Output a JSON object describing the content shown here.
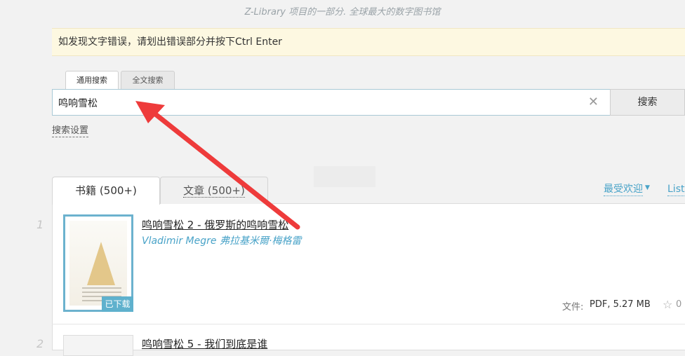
{
  "header": {
    "tagline": "Z-Library 项目的一部分. 全球最大的数字图书馆"
  },
  "notice": {
    "text": "如发现文字错误，请划出错误部分并按下Ctrl Enter"
  },
  "search": {
    "tabs": [
      {
        "label": "通用搜索"
      },
      {
        "label": "全文搜索"
      }
    ],
    "query": "鸣响雪松",
    "clear_icon": "close-icon",
    "button_label": "搜索",
    "settings_label": "搜索设置"
  },
  "results": {
    "tabs": [
      {
        "label": "书籍 (500+)"
      },
      {
        "label": "文章 (500+)"
      }
    ],
    "sort_label": "最受欢迎",
    "view_label": "List",
    "items": [
      {
        "number": "1",
        "title": "鸣响雪松 2 - 俄罗斯的鸣响雪松",
        "author": "Vladimir Megre 弗拉基米爾·梅格雷",
        "badge": "已下载",
        "file_label": "文件:",
        "file_info": "PDF, 5.27 MB",
        "star_count": "0"
      },
      {
        "number": "2",
        "title": "鸣响雪松 5 - 我们到底是谁"
      }
    ]
  },
  "colors": {
    "accent": "#49a3c8",
    "annotation_arrow": "#ee3b3b"
  }
}
